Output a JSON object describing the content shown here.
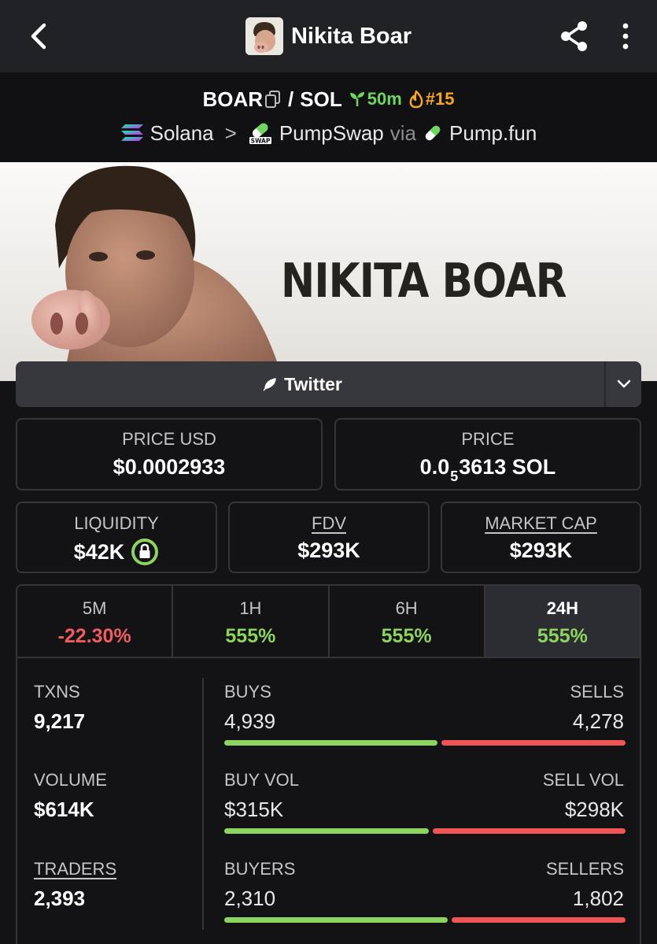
{
  "header": {
    "title": "Nikita Boar"
  },
  "pair": {
    "base": "BOAR",
    "separator": "/",
    "quote": "SOL",
    "age": "50m",
    "rank": "#15"
  },
  "breadcrumb": {
    "chain": "Solana",
    "arrow": ">",
    "dex": "PumpSwap",
    "via_label": "via",
    "launchpad": "Pump.fun"
  },
  "banner": {
    "text": "NIKITA BOAR"
  },
  "links": {
    "twitter_label": "Twitter"
  },
  "price": {
    "usd_label": "PRICE USD",
    "usd_value": "$0.0002933",
    "native_label": "PRICE",
    "native_prefix": "0.0",
    "native_zeros": "5",
    "native_suffix": "3613 SOL"
  },
  "metrics": {
    "liquidity_label": "LIQUIDITY",
    "liquidity_value": "$42K",
    "fdv_label": "FDV",
    "fdv_value": "$293K",
    "mcap_label": "MARKET CAP",
    "mcap_value": "$293K"
  },
  "timeframes": [
    {
      "label": "5M",
      "value": "-22.30%"
    },
    {
      "label": "1H",
      "value": "555%"
    },
    {
      "label": "6H",
      "value": "555%"
    },
    {
      "label": "24H",
      "value": "555%"
    }
  ],
  "stats": {
    "txns_label": "TXNS",
    "txns_value": "9,217",
    "volume_label": "VOLUME",
    "volume_value": "$614K",
    "traders_label": "TRADERS",
    "traders_value": "2,393",
    "buys_label": "BUYS",
    "buys_value": "4,939",
    "sells_label": "SELLS",
    "sells_value": "4,278",
    "buy_vol_label": "BUY VOL",
    "buy_vol_value": "$315K",
    "sell_vol_label": "SELL VOL",
    "sell_vol_value": "$298K",
    "buyers_label": "BUYERS",
    "buyers_value": "2,310",
    "sellers_label": "SELLERS",
    "sellers_value": "1,802",
    "buys_ratio": 0.536,
    "volume_ratio": 0.514,
    "buyers_ratio": 0.562
  },
  "colors": {
    "positive": "#8dd35f",
    "negative": "#f05d5d",
    "age_green": "#6fd65f",
    "rank_orange": "#f7a427"
  },
  "icons": [
    "back-arrow-icon",
    "share-icon",
    "more-vert-icon",
    "copy-icon",
    "seedling-icon",
    "flame-icon",
    "solana-icon",
    "pumpswap-icon",
    "pill-icon",
    "feather-icon",
    "chevron-down-icon",
    "lock-icon"
  ]
}
